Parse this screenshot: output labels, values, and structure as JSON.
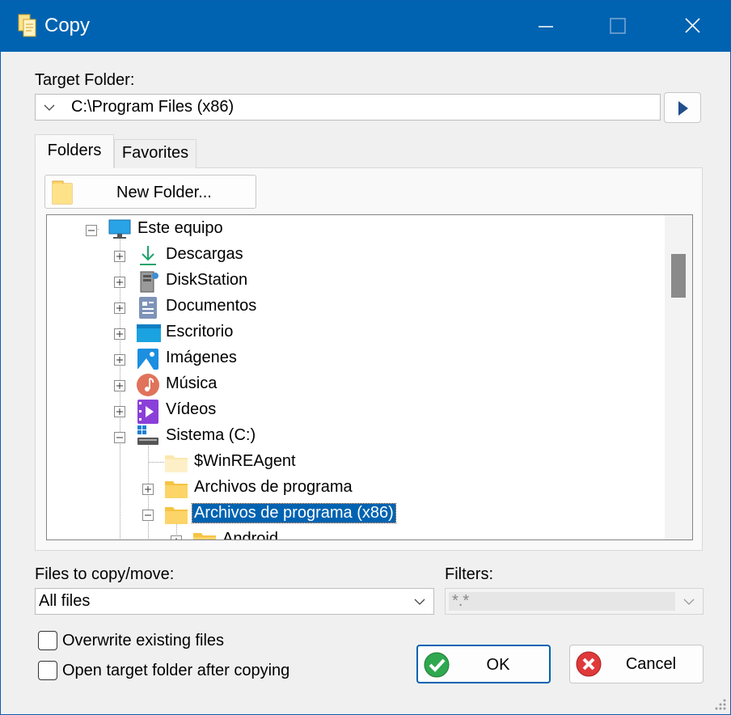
{
  "window": {
    "title": "Copy",
    "title_icon": "copy-icon",
    "controls": [
      "minimize-icon",
      "maximize-icon",
      "close-icon"
    ]
  },
  "target": {
    "label": "Target Folder:",
    "value": "C:\\Program Files (x86)",
    "go_icon": "play-arrow-icon"
  },
  "tabs": [
    {
      "label": "Folders",
      "active": true
    },
    {
      "label": "Favorites",
      "active": false
    }
  ],
  "new_folder": {
    "label": "New Folder...",
    "icon": "folder-icon"
  },
  "tree": {
    "nodes": [
      {
        "label": "Este equipo",
        "icon": "monitor-icon",
        "expander": "minus"
      },
      {
        "label": "Descargas",
        "icon": "download-icon",
        "expander": "plus"
      },
      {
        "label": "DiskStation",
        "icon": "nas-icon",
        "expander": "plus"
      },
      {
        "label": "Documentos",
        "icon": "documents-icon",
        "expander": "plus"
      },
      {
        "label": "Escritorio",
        "icon": "desktop-icon",
        "expander": "plus"
      },
      {
        "label": "Imágenes",
        "icon": "pictures-icon",
        "expander": "plus"
      },
      {
        "label": "Música",
        "icon": "music-icon",
        "expander": "plus"
      },
      {
        "label": "Vídeos",
        "icon": "videos-icon",
        "expander": "plus"
      },
      {
        "label": "Sistema (C:)",
        "icon": "drive-icon",
        "expander": "minus"
      },
      {
        "label": "$WinREAgent",
        "icon": "folder-icon",
        "expander": "none"
      },
      {
        "label": "Archivos de programa",
        "icon": "folder-icon",
        "expander": "plus"
      },
      {
        "label": "Archivos de programa (x86)",
        "icon": "folder-icon",
        "expander": "minus",
        "selected": true
      },
      {
        "label": "Android",
        "icon": "folder-icon",
        "expander": "plus"
      }
    ]
  },
  "files": {
    "label": "Files to copy/move:",
    "value": "All files"
  },
  "filters": {
    "label": "Filters:",
    "value": "*.*"
  },
  "options": [
    {
      "label": "Overwrite existing files",
      "checked": false
    },
    {
      "label": "Open target folder after copying",
      "checked": false
    }
  ],
  "buttons": {
    "ok": {
      "label": "OK",
      "icon": "check-circle-icon"
    },
    "cancel": {
      "label": "Cancel",
      "icon": "cancel-circle-icon"
    }
  },
  "colors": {
    "accent": "#0063b1",
    "selection": "#0063b1",
    "titlebar": "#0063b1"
  }
}
